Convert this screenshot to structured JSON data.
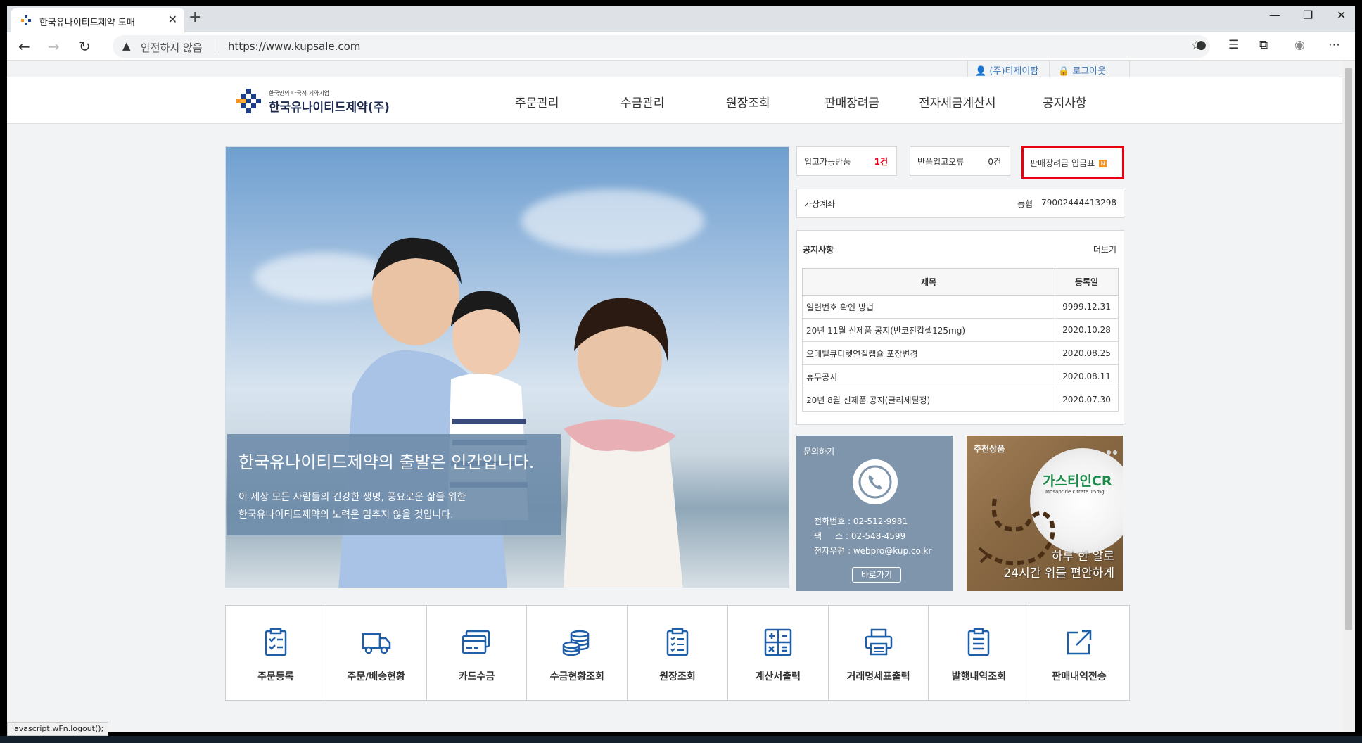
{
  "browser": {
    "tab_title": "한국유나이티드제약 도매",
    "security_label": "안전하지 않음",
    "url": "https://www.kupsale.com"
  },
  "topbar": {
    "user": "(주)티제이팜",
    "logout": "로그아웃"
  },
  "logo": {
    "sub": "한국인의 다국적 제약기업",
    "main": "한국유나이티드제약(주)"
  },
  "nav": [
    "주문관리",
    "수금관리",
    "원장조회",
    "판매장려금",
    "전자세금계산서",
    "공지사항"
  ],
  "hero": {
    "title": "한국유나이티드제약의 출발은 인간입니다.",
    "desc1": "이 세상 모든 사람들의 건강한 생명, 풍요로운 삶을 위한",
    "desc2": "한국유나이티드제약의 노력은 멈추지 않을 것입니다."
  },
  "status_boxes": {
    "returns_available_label": "입고가능반품",
    "returns_available_count": "1건",
    "returns_error_label": "반품입고오류",
    "returns_error_count": "0건",
    "incentive_slip_label": "판매장려금 입금표",
    "new_badge": "N"
  },
  "virtual_account": {
    "label": "가상계좌",
    "bank": "농협",
    "number": "79002444413298"
  },
  "notice": {
    "title": "공지사항",
    "more": "더보기",
    "headers": {
      "subject": "제목",
      "date": "등록일"
    },
    "rows": [
      {
        "subject": "일련번호 확인 방법",
        "date": "9999.12.31"
      },
      {
        "subject": "20년 11월 신제품 공지(반코진캅셀125mg)",
        "date": "2020.10.28"
      },
      {
        "subject": "오메틸큐티렛연질캡슐 포장변경",
        "date": "2020.08.25"
      },
      {
        "subject": "휴무공지",
        "date": "2020.08.11"
      },
      {
        "subject": "20년 8월 신제품 공지(글리세틸정)",
        "date": "2020.07.30"
      }
    ]
  },
  "contact": {
    "title": "문의하기",
    "phone": "전화번호 : 02-512-9981",
    "fax": "팩     스 : 02-548-4599",
    "email": "전자우편 : webpro@kup.co.kr",
    "button": "바로가기"
  },
  "recommend": {
    "title": "추천상품",
    "brand": "가스티인CR",
    "brand_sub": "Mosapride citrate 15mg",
    "copy1": "하루 한 알로",
    "copy2": "24시간 위를 편안하게"
  },
  "quick_menu": [
    {
      "label": "주문등록",
      "icon": "order-form-icon"
    },
    {
      "label": "주문/배송현황",
      "icon": "delivery-truck-icon"
    },
    {
      "label": "카드수금",
      "icon": "credit-card-icon"
    },
    {
      "label": "수금현황조회",
      "icon": "coins-icon"
    },
    {
      "label": "원장조회",
      "icon": "ledger-clipboard-icon"
    },
    {
      "label": "계산서출력",
      "icon": "calculator-icon"
    },
    {
      "label": "거래명세표출력",
      "icon": "printer-icon"
    },
    {
      "label": "발행내역조회",
      "icon": "document-list-icon"
    },
    {
      "label": "판매내역전송",
      "icon": "external-send-icon"
    }
  ],
  "status_bar_url": "javascript:wFn.logout();",
  "colors": {
    "accent_blue": "#3c77b8",
    "highlight_red": "#e60012",
    "count_red": "#e60012",
    "contact_bg": "#7f95ab",
    "icon_blue": "#1f5fa8"
  }
}
